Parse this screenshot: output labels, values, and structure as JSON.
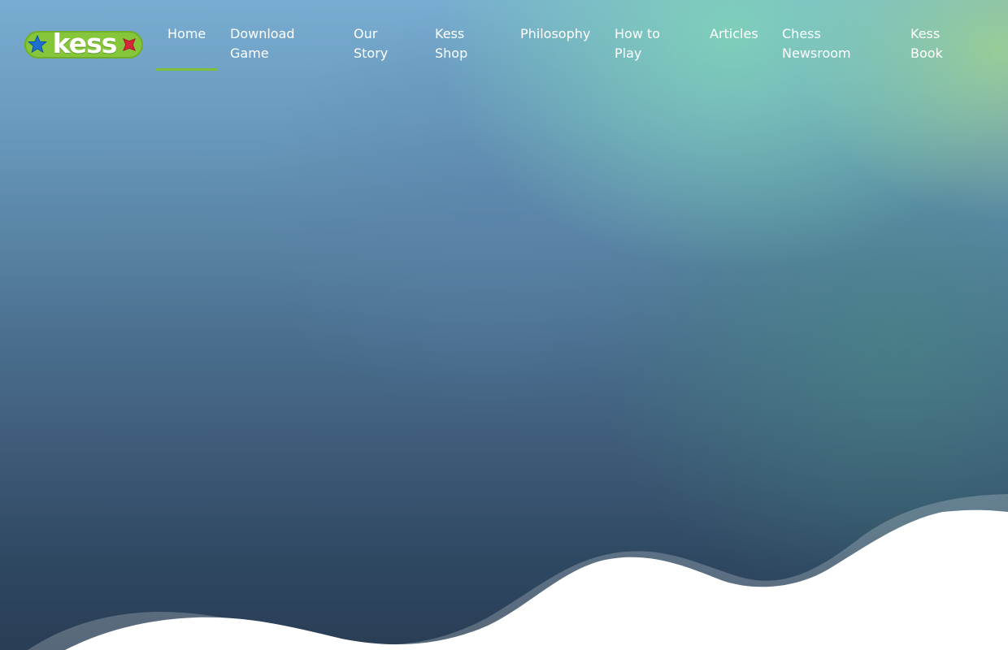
{
  "brand": {
    "logo_text": "kess",
    "colors": {
      "logo_green": "#86c63a",
      "star_blue": "#1f6fd1",
      "star_red": "#d8263a",
      "active_underline": "#7ec03a"
    }
  },
  "nav": {
    "items": [
      {
        "label": "Home",
        "active": true
      },
      {
        "label": "Download\nGame",
        "active": false
      },
      {
        "label": "Our\nStory",
        "active": false
      },
      {
        "label": "Kess\nShop",
        "active": false
      },
      {
        "label": "Philosophy",
        "active": false
      },
      {
        "label": "How to\nPlay",
        "active": false
      },
      {
        "label": "Articles",
        "active": false
      },
      {
        "label": "Chess\nNewsroom",
        "active": false
      },
      {
        "label": "Kess\nBook",
        "active": false
      }
    ]
  },
  "icons": {
    "left_star": "blue-star-icon",
    "right_star": "red-star-icon"
  }
}
